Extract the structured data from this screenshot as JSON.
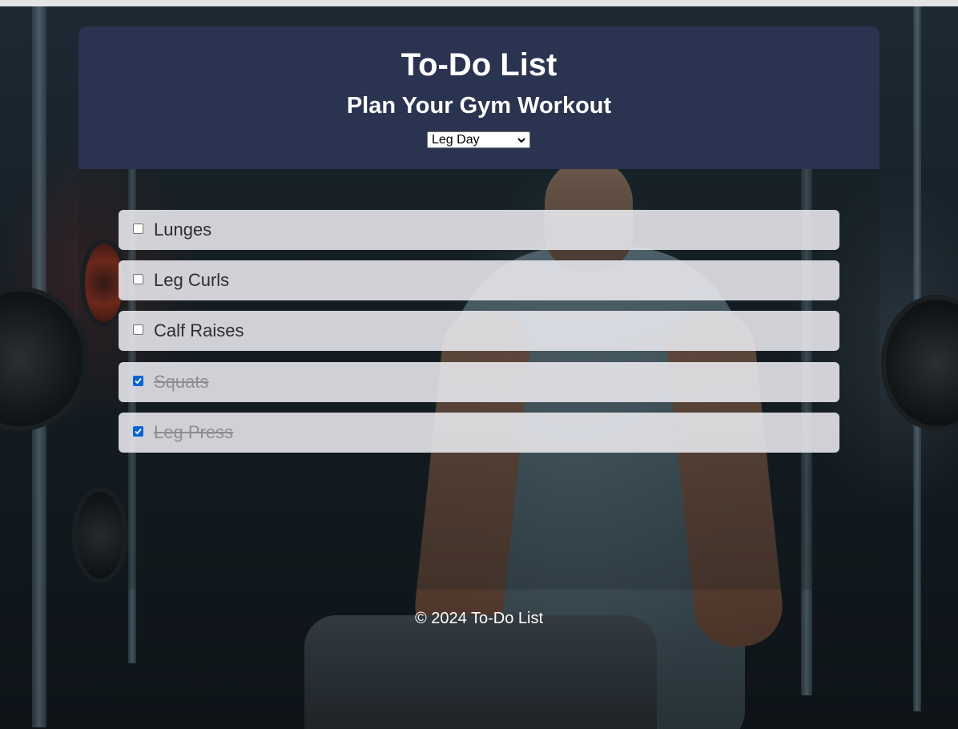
{
  "header": {
    "title": "To-Do List",
    "subtitle": "Plan Your Gym Workout"
  },
  "workout_select": {
    "selected": "Leg Day"
  },
  "tasks": [
    {
      "label": "Lunges",
      "checked": false
    },
    {
      "label": "Leg Curls",
      "checked": false
    },
    {
      "label": "Calf Raises",
      "checked": false
    },
    {
      "label": "Squats",
      "checked": true
    },
    {
      "label": "Leg Press",
      "checked": true
    }
  ],
  "footer": {
    "text": "© 2024 To-Do List"
  },
  "colors": {
    "header_bg": "#2a3450",
    "checkbox_checked": "#0a64d6",
    "item_bg": "#ebebf0"
  },
  "icons": {
    "select_caret": "chevron-down-icon",
    "check": "checkmark-icon"
  }
}
